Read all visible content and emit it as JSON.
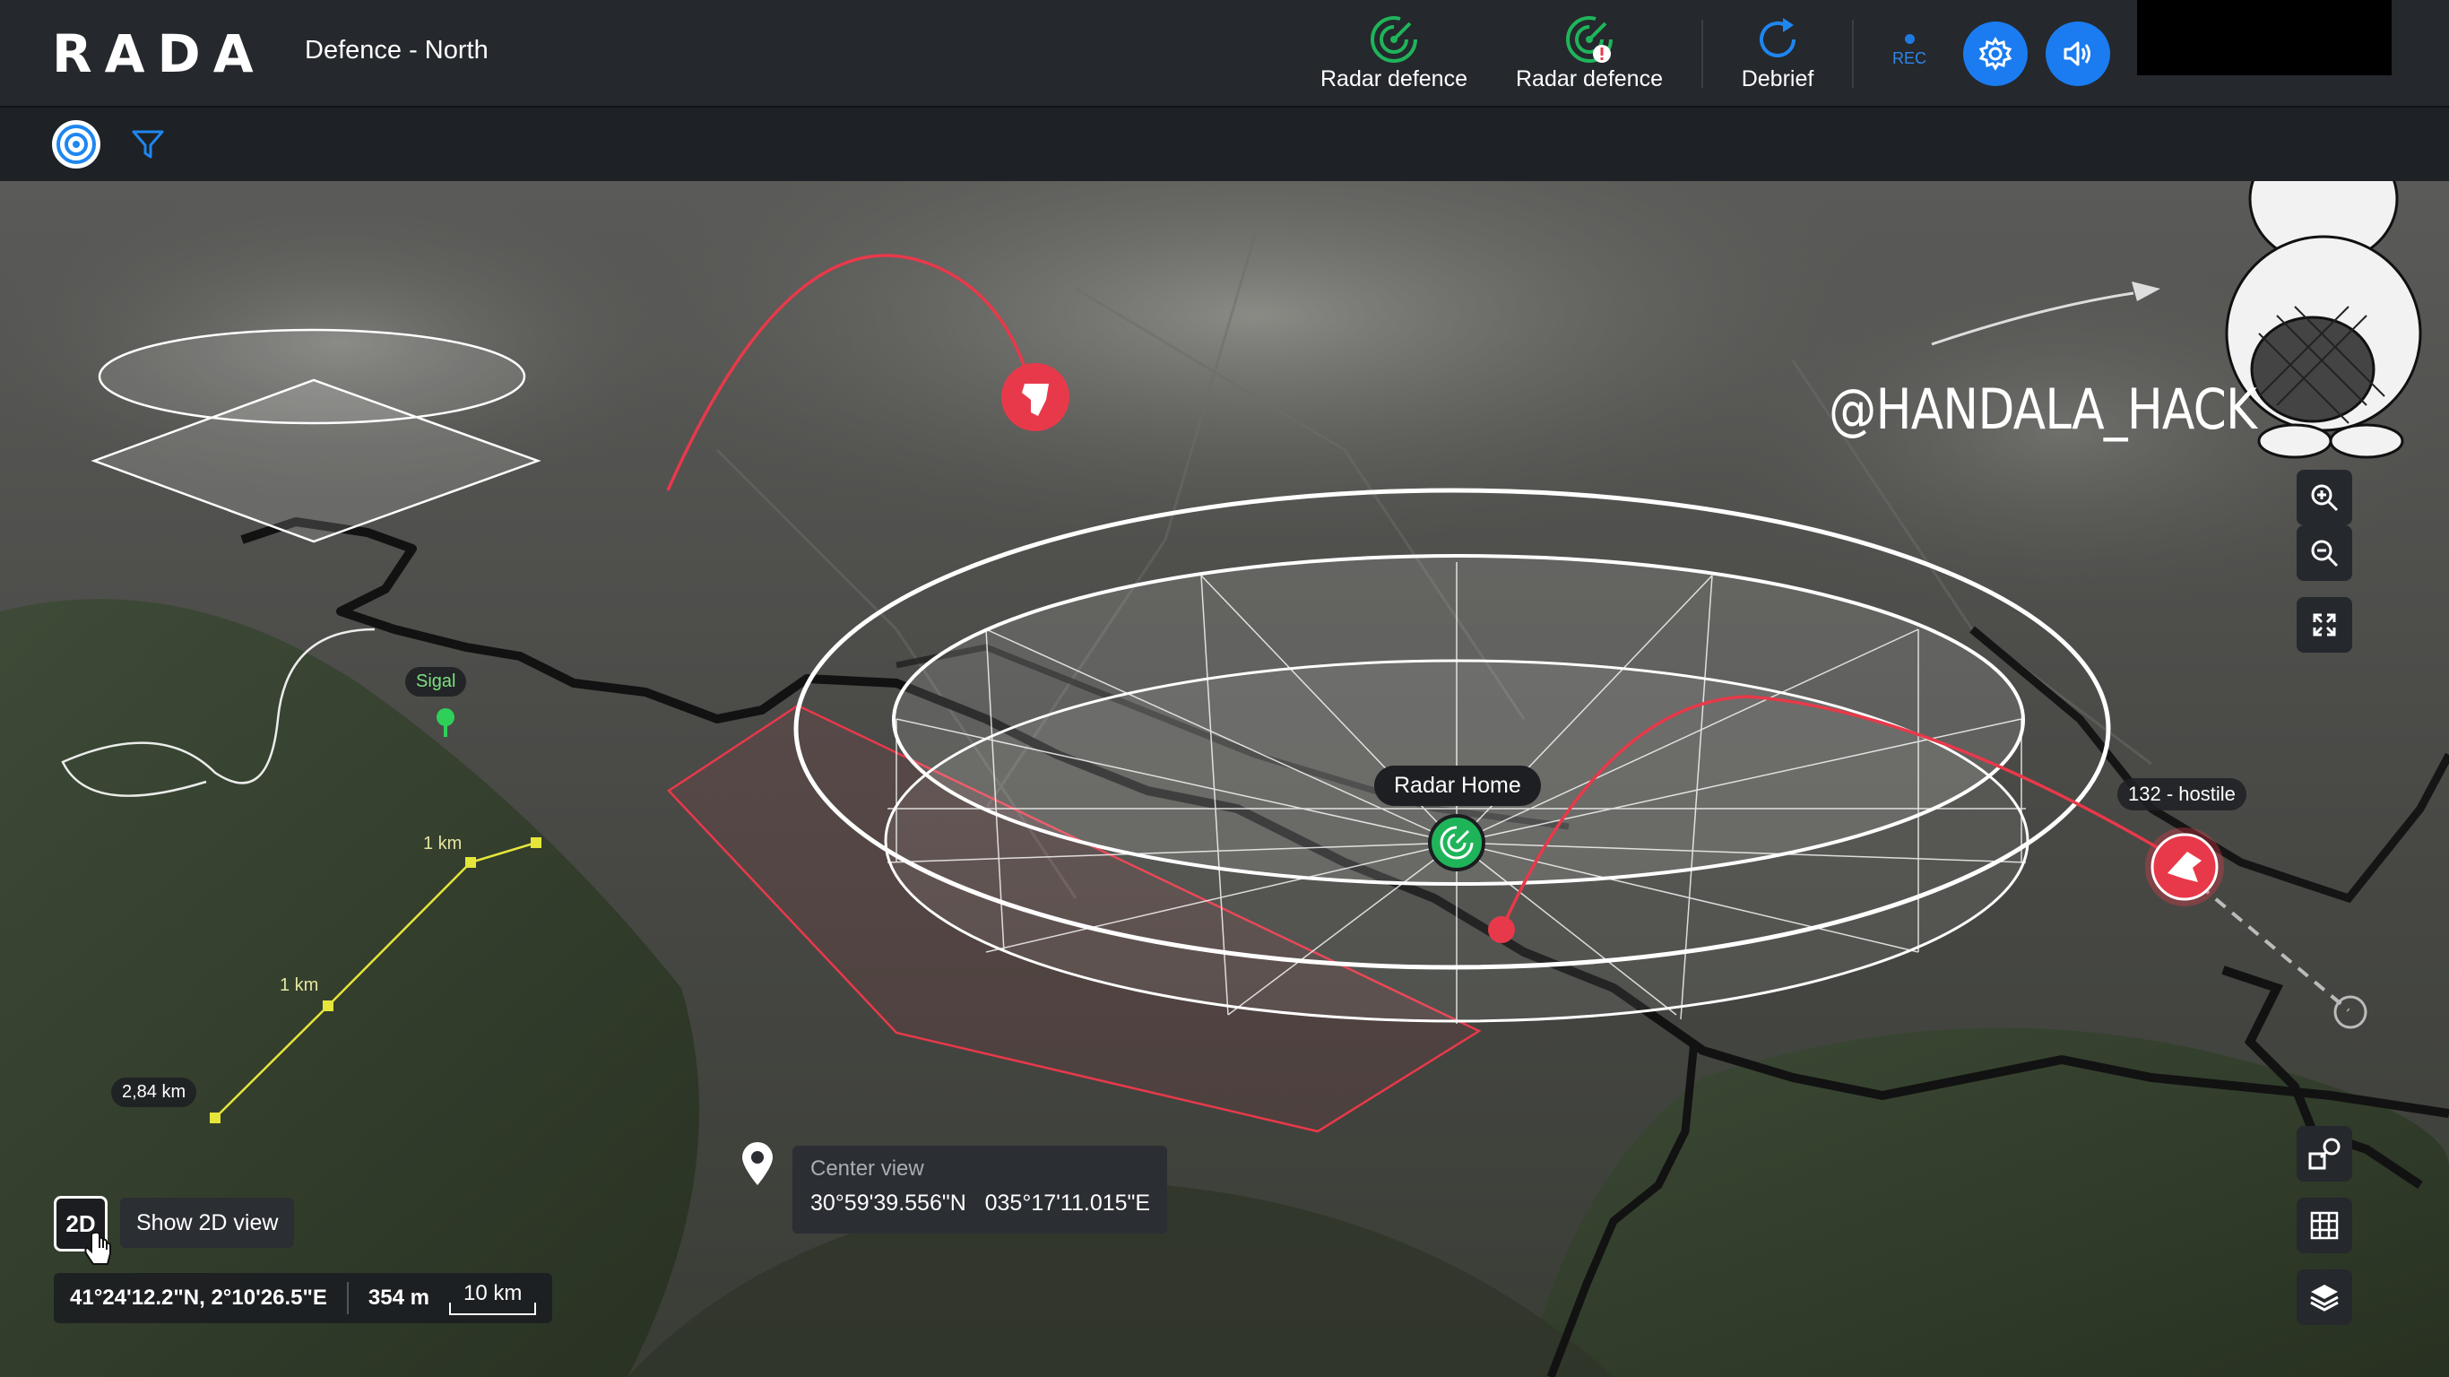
{
  "app": {
    "logo": "RADA",
    "title": "Defence - North"
  },
  "toolbar": {
    "tools": [
      {
        "label": "Radar defence",
        "icon": "radar-icon"
      },
      {
        "label": "Radar defence",
        "icon": "radar-alert-icon"
      },
      {
        "label": "Debrief",
        "icon": "refresh-icon"
      }
    ],
    "rec_label": "REC",
    "settings_icon": "gear-icon",
    "sound_icon": "speaker-icon"
  },
  "subbar": {
    "layers_icon": "target-icon",
    "filter_icon": "filter-icon"
  },
  "overlay": {
    "hack_text": "@HANDALA_HACK"
  },
  "map": {
    "site_label": "Sigal",
    "radar_label": "Radar Home",
    "track_label": "132 - hostile",
    "ruler": {
      "seg1": "1 km",
      "seg2": "1 km",
      "total": "2,84 km"
    },
    "center_view": {
      "title": "Center view",
      "lat": "30°59'39.556\"N",
      "lon": "035°17'11.015\"E"
    },
    "btn_2d": "2D",
    "tooltip_2d": "Show 2D view",
    "status": {
      "cursor_coords": "41°24'12.2\"N, 2°10'26.5\"E",
      "altitude": "354 m",
      "scale": "10 km"
    }
  },
  "colors": {
    "accent": "#1a7cf0",
    "radar_green": "#1fb45a",
    "hostile_red": "#e8394a",
    "ruler_yellow": "#e6e63a"
  }
}
